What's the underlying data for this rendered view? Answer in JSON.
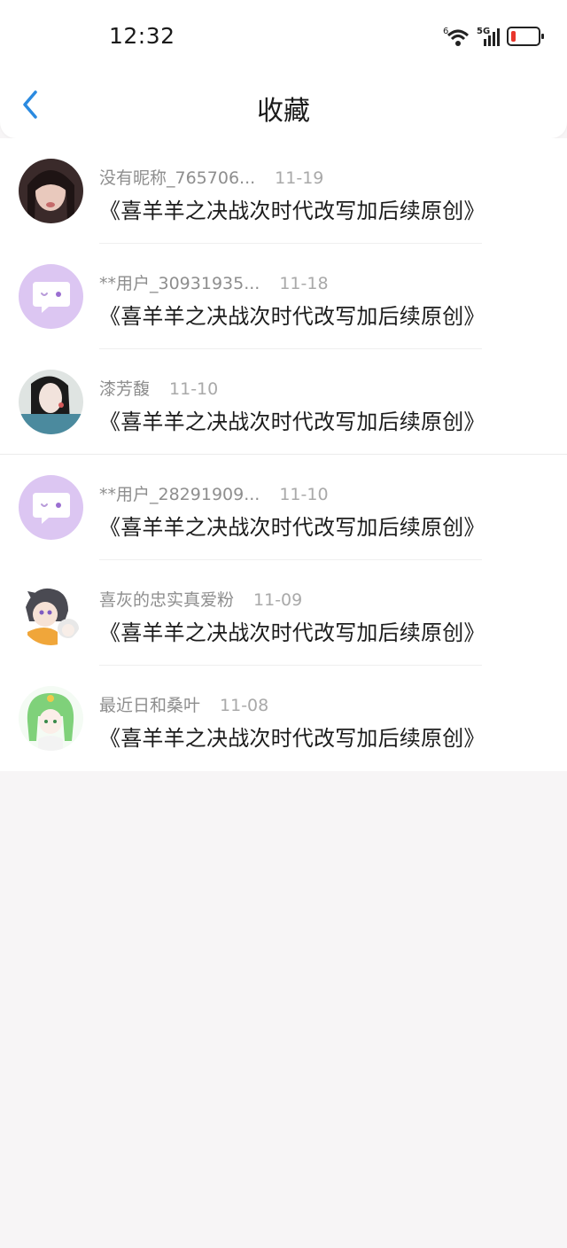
{
  "status_bar": {
    "time": "12:32",
    "network": "5G",
    "wifi_badge": "6",
    "battery_color": "#e8362c"
  },
  "nav": {
    "title": "收藏",
    "back_icon": "chevron-left-icon",
    "accent": "#2b8ae0"
  },
  "items": [
    {
      "name": "没有昵称_765706...",
      "date": "11-19",
      "title": "《喜羊羊之决战次时代改写加后续原创》",
      "avatar": "photo"
    },
    {
      "name": "**用户_30931935...",
      "date": "11-18",
      "title": "《喜羊羊之决战次时代改写加后续原创》",
      "avatar": "chat"
    },
    {
      "name": "漆芳馥",
      "date": "11-10",
      "title": "《喜羊羊之决战次时代改写加后续原创》",
      "avatar": "photo"
    },
    {
      "name": "**用户_28291909...",
      "date": "11-10",
      "title": "《喜羊羊之决战次时代改写加后续原创》",
      "avatar": "chat"
    },
    {
      "name": "喜灰的忠实真爱粉",
      "date": "11-09",
      "title": "《喜羊羊之决战次时代改写加后续原创》",
      "avatar": "anime"
    },
    {
      "name": "最近日和桑叶",
      "date": "11-08",
      "title": "《喜羊羊之决战次时代改写加后续原创》",
      "avatar": "anime"
    }
  ]
}
